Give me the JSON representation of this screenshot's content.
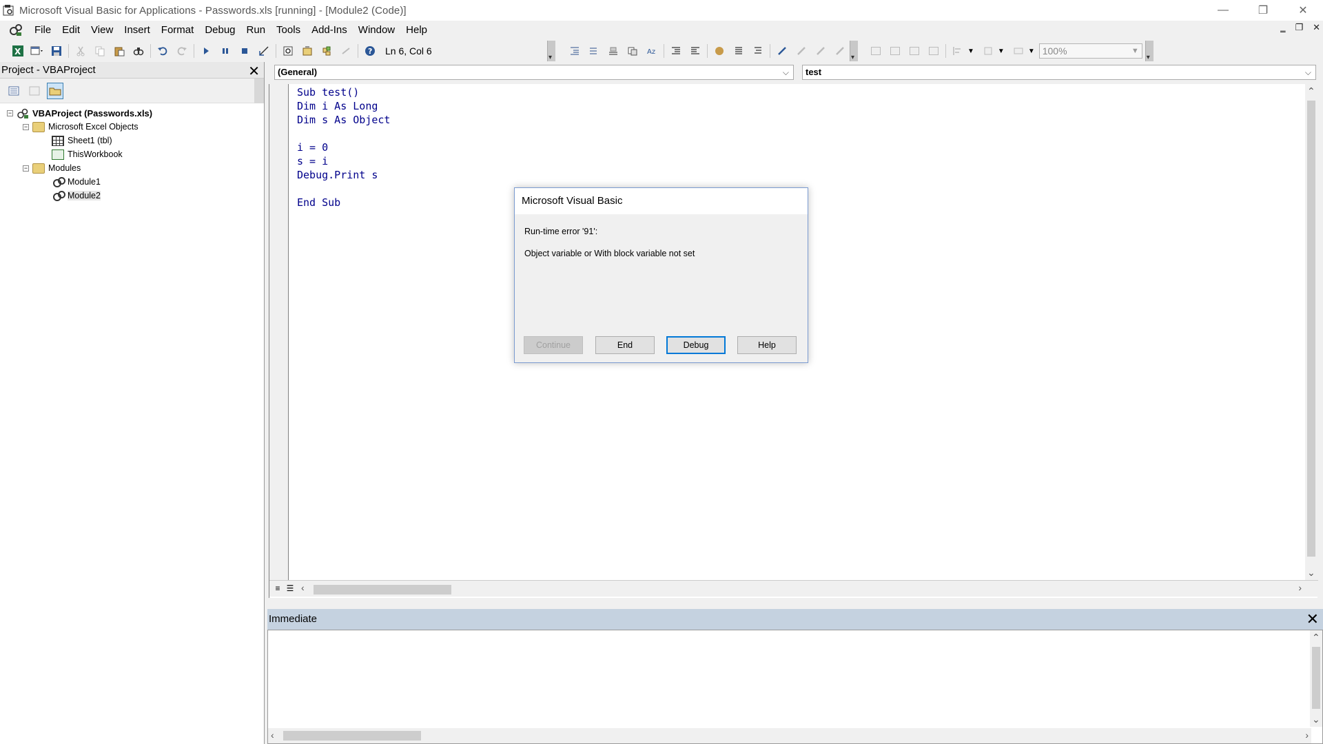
{
  "window": {
    "title": "Microsoft Visual Basic for Applications - Passwords.xls [running] - [Module2 (Code)]",
    "controls": {
      "minimize": "—",
      "restore": "❐",
      "close": "✕"
    }
  },
  "menubar": {
    "items": [
      "File",
      "Edit",
      "View",
      "Insert",
      "Format",
      "Debug",
      "Run",
      "Tools",
      "Add-Ins",
      "Window",
      "Help"
    ],
    "mdi_controls": {
      "minimize": "‗",
      "restore": "❐",
      "close": "✕"
    }
  },
  "toolbar": {
    "position_text": "Ln 6, Col 6",
    "zoom_value": "100%"
  },
  "project_pane": {
    "title": "Project - VBAProject",
    "close_label": "✕",
    "tree": {
      "root": "VBAProject (Passwords.xls)",
      "excel_objects_folder": "Microsoft Excel Objects",
      "sheet1": "Sheet1 (tbl)",
      "thisworkbook": "ThisWorkbook",
      "modules_folder": "Modules",
      "module1": "Module1",
      "module2": "Module2"
    }
  },
  "code_window": {
    "object_selector": "(General)",
    "procedure_selector": "test",
    "lines": [
      "Sub test()",
      "Dim i As Long",
      "Dim s As Object",
      "",
      "i = 0",
      "s = i",
      "Debug.Print s",
      "",
      "End Sub"
    ]
  },
  "immediate": {
    "title": "Immediate",
    "close_label": "✕"
  },
  "dialog": {
    "title": "Microsoft Visual Basic",
    "error_line": "Run-time error '91':",
    "message": "Object variable or With block variable not set",
    "buttons": {
      "continue": "Continue",
      "end": "End",
      "debug": "Debug",
      "help": "Help"
    }
  },
  "colors": {
    "keyword": "#00008b",
    "immediate_header": "#c5d2e0",
    "default_button_border": "#0078d7"
  }
}
